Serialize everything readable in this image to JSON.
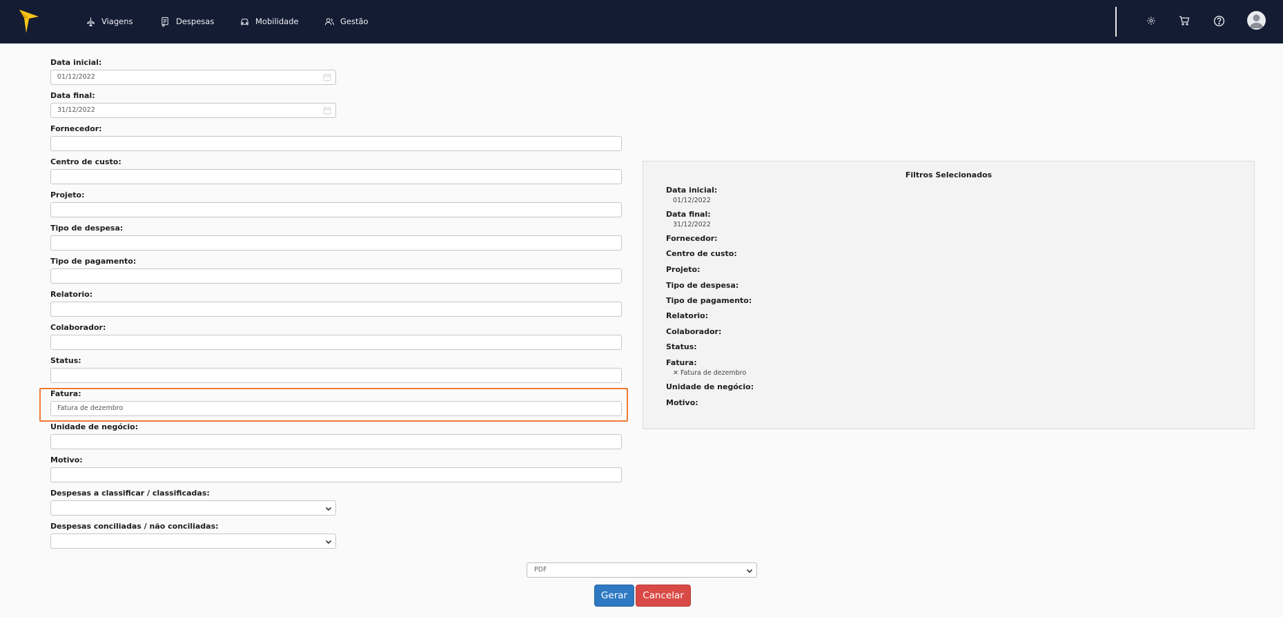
{
  "nav": {
    "items": [
      {
        "label": "Viagens",
        "icon": "plane-icon"
      },
      {
        "label": "Despesas",
        "icon": "receipt-icon"
      },
      {
        "label": "Mobilidade",
        "icon": "car-icon"
      },
      {
        "label": "Gestão",
        "icon": "users-icon"
      }
    ],
    "right_icons": [
      "gear-icon",
      "cart-icon",
      "help-icon",
      "avatar-icon"
    ]
  },
  "form": {
    "data_inicial": {
      "label": "Data inicial:",
      "value": "01/12/2022"
    },
    "data_final": {
      "label": "Data final:",
      "value": "31/12/2022"
    },
    "fornecedor": {
      "label": "Fornecedor:",
      "value": ""
    },
    "centro_custo": {
      "label": "Centro de custo:",
      "value": ""
    },
    "projeto": {
      "label": "Projeto:",
      "value": ""
    },
    "tipo_despesa": {
      "label": "Tipo de despesa:",
      "value": ""
    },
    "tipo_pagamento": {
      "label": "Tipo de pagamento:",
      "value": ""
    },
    "relatorio": {
      "label": "Relatorio:",
      "value": ""
    },
    "colaborador": {
      "label": "Colaborador:",
      "value": ""
    },
    "status": {
      "label": "Status:",
      "value": ""
    },
    "fatura": {
      "label": "Fatura:",
      "value": "Fatura de dezembro"
    },
    "unidade_negocio": {
      "label": "Unidade de negócio:",
      "value": ""
    },
    "motivo": {
      "label": "Motivo:",
      "value": ""
    },
    "classificar": {
      "label": "Despesas a classificar / classificadas:",
      "value": ""
    },
    "conciliadas": {
      "label": "Despesas conciliadas / não conciliadas:",
      "value": ""
    }
  },
  "panel": {
    "title": "Filtros Selecionados",
    "data_inicial": {
      "label": "Data inicial:",
      "value": "01/12/2022"
    },
    "data_final": {
      "label": "Data final:",
      "value": "31/12/2022"
    },
    "fornecedor": "Fornecedor:",
    "centro_custo": "Centro de custo:",
    "projeto": "Projeto:",
    "tipo_despesa": "Tipo de despesa:",
    "tipo_pagamento": "Tipo de pagamento:",
    "relatorio": "Relatorio:",
    "colaborador": "Colaborador:",
    "status": "Status:",
    "fatura": {
      "label": "Fatura:",
      "value": "✕ Fatura de dezembro"
    },
    "unidade_negocio": "Unidade de negócio:",
    "motivo": "Motivo:"
  },
  "footer": {
    "format": "PDF",
    "gerar": "Gerar",
    "cancelar": "Cancelar"
  },
  "colors": {
    "topbar": "#141c33",
    "accent_highlight": "#f07a32",
    "primary": "#2f79c2",
    "danger": "#d94a46"
  }
}
